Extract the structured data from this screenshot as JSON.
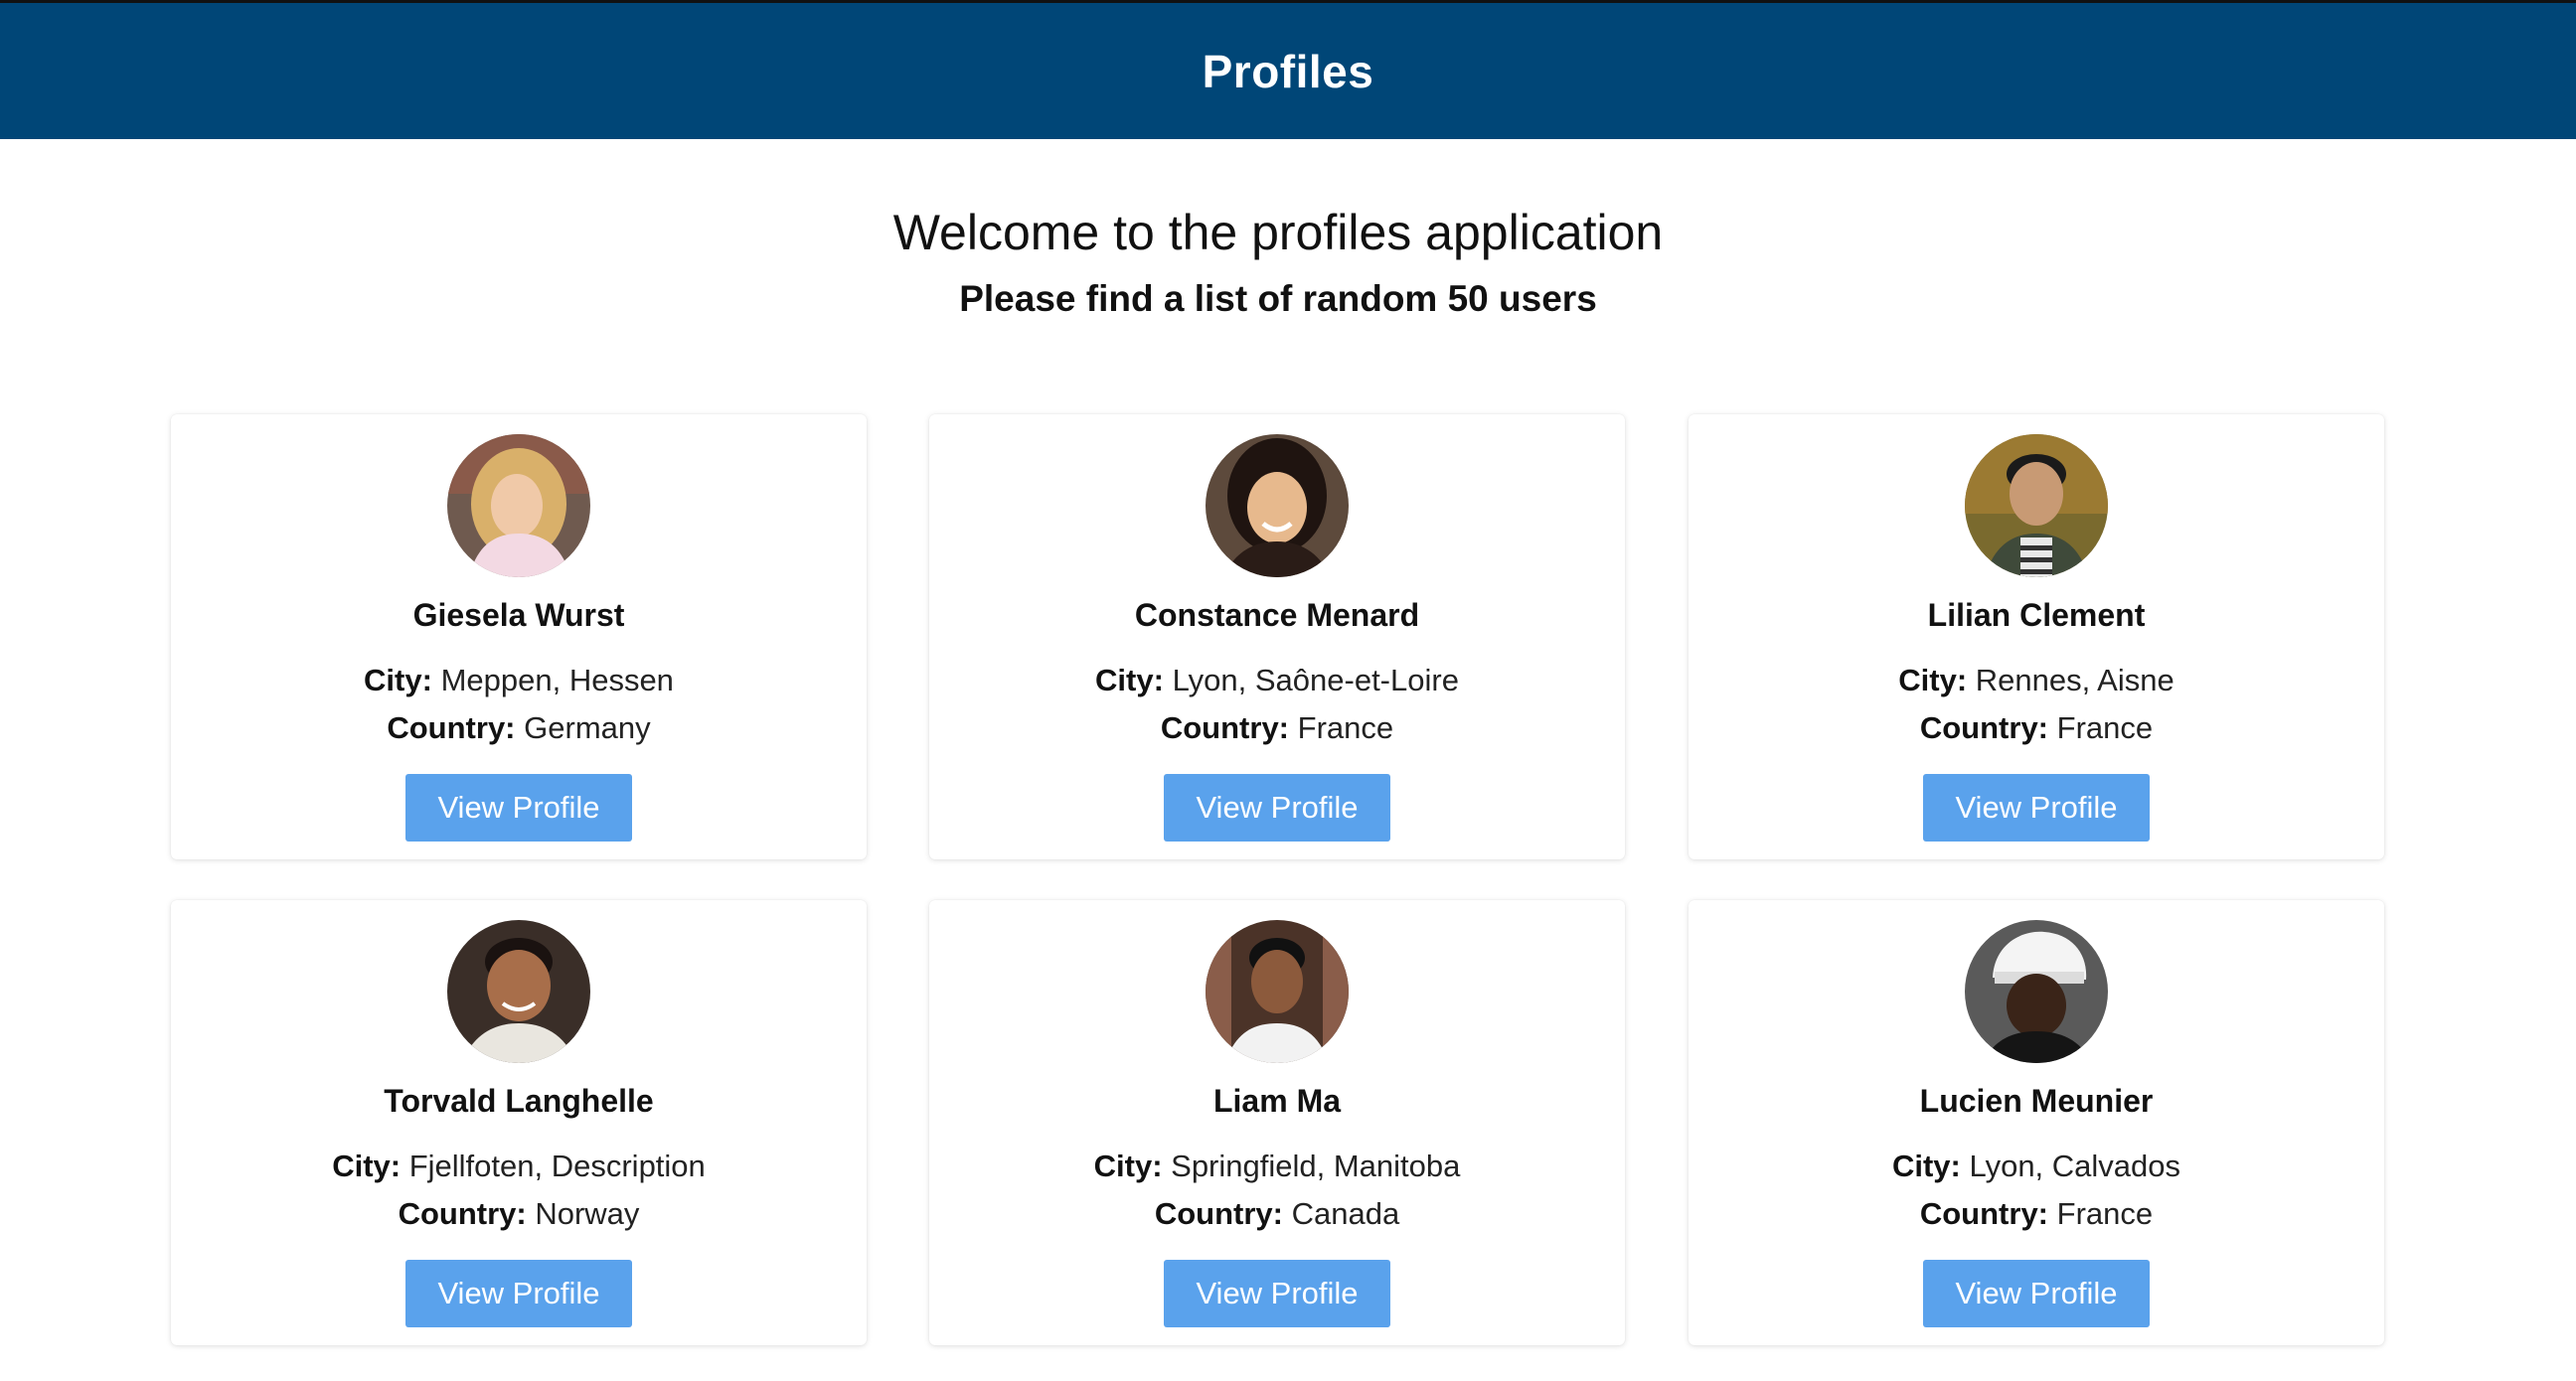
{
  "header": {
    "title": "Profiles"
  },
  "intro": {
    "welcome": "Welcome to the profiles application",
    "subtitle": "Please find a list of random 50 users"
  },
  "labels": {
    "city": "City:",
    "country": "Country:",
    "button": "View Profile"
  },
  "colors": {
    "header_bg": "#004677",
    "button_bg": "#5aa2ec"
  },
  "profiles": [
    {
      "name": "Giesela Wurst",
      "city": "Meppen, Hessen",
      "country": "Germany"
    },
    {
      "name": "Constance Menard",
      "city": "Lyon, Saône-et-Loire",
      "country": "France"
    },
    {
      "name": "Lilian Clement",
      "city": "Rennes, Aisne",
      "country": "France"
    },
    {
      "name": "Torvald Langhelle",
      "city": "Fjellfoten, Description",
      "country": "Norway"
    },
    {
      "name": "Liam Ma",
      "city": "Springfield, Manitoba",
      "country": "Canada"
    },
    {
      "name": "Lucien Meunier",
      "city": "Lyon, Calvados",
      "country": "France"
    }
  ]
}
